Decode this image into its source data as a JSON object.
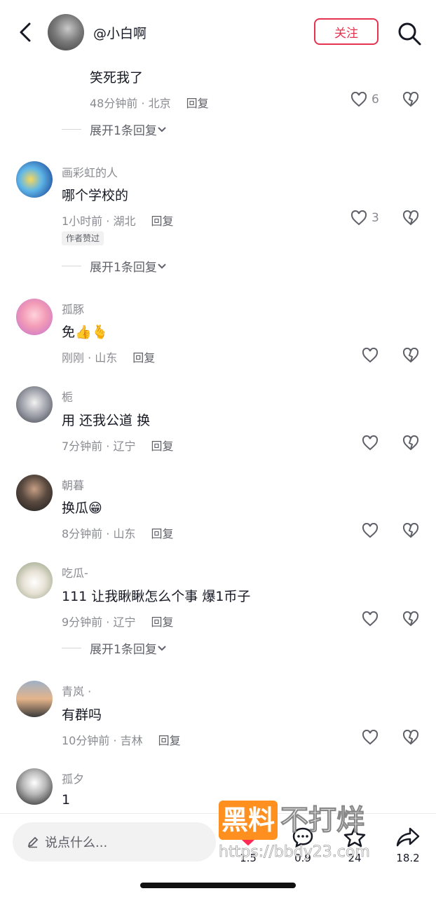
{
  "header": {
    "username": "@小白啊",
    "follow_label": "关注"
  },
  "top_reply": {
    "text": "笑死我了",
    "meta": "48分钟前 · 北京",
    "reply_label": "回复",
    "likes": "6",
    "expand_label": "展开1条回复"
  },
  "comments": [
    {
      "name": "画彩虹的人",
      "text": "哪个学校的",
      "meta": "1小时前 · 湖北",
      "reply_label": "回复",
      "likes": "3",
      "badge": "作者赞过",
      "expand_label": "展开1条回复"
    },
    {
      "name": "孤豚",
      "text": "免👍🫰",
      "meta": "刚刚 · 山东",
      "reply_label": "回复",
      "likes": ""
    },
    {
      "name": "栀",
      "text": "用 还我公道 换",
      "meta": "7分钟前 · 辽宁",
      "reply_label": "回复",
      "likes": ""
    },
    {
      "name": "朝暮",
      "text": "换瓜😁",
      "meta": "8分钟前 · 山东",
      "reply_label": "回复",
      "likes": ""
    },
    {
      "name": "吃瓜-",
      "text": "111 让我瞅瞅怎么个事 爆1币子",
      "meta": "9分钟前 · 辽宁",
      "reply_label": "回复",
      "likes": "",
      "expand_label": "展开1条回复"
    },
    {
      "name": "青岚 ·",
      "text": "有群吗",
      "meta": "10分钟前 · 吉林",
      "reply_label": "回复",
      "likes": ""
    },
    {
      "name": "孤夕",
      "text": "1"
    }
  ],
  "bottom": {
    "input_placeholder": "说点什么...",
    "like_count": "1.5",
    "comment_count": "0.9",
    "star_count": "24",
    "share_count": "18.2"
  },
  "watermark": {
    "brand": "黑料",
    "tagline": "不打烊",
    "url": "https://bbdy23.com"
  },
  "colors": {
    "accent": "#e5334f",
    "text": "#161823",
    "muted": "#8a8b91",
    "watermark": "#ff8f1f"
  }
}
